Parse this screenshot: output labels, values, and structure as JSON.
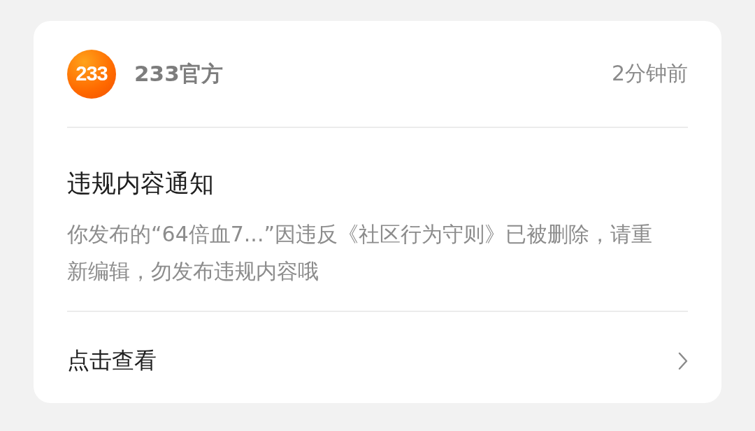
{
  "sender": {
    "logo_text": "233",
    "name": "233官方",
    "time": "2分钟前"
  },
  "notice": {
    "title": "违规内容通知",
    "body": "你发布的“64倍血7...”因违反《社区行为守则》已被删除，请重新编辑，勿发布违规内容哦"
  },
  "action": {
    "label": "点击查看"
  }
}
